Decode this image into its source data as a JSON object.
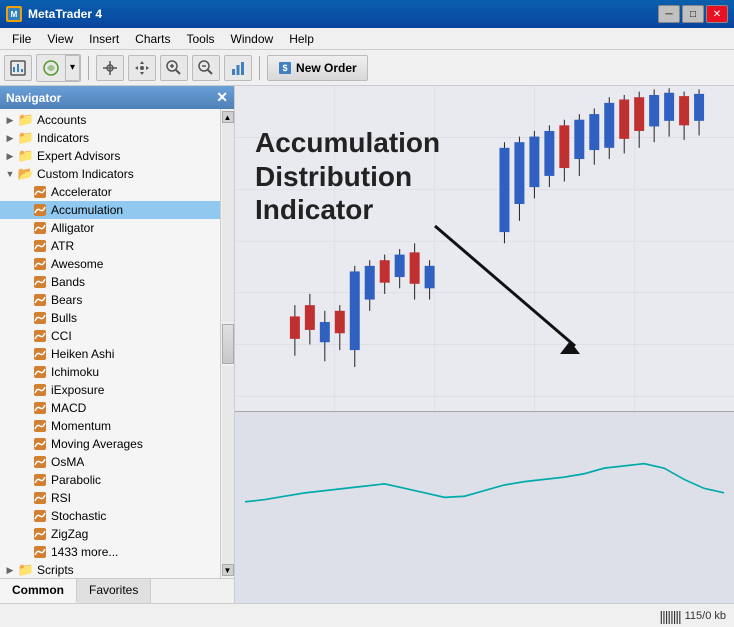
{
  "titleBar": {
    "title": "MetaTrader 4",
    "iconLabel": "MT",
    "controls": [
      "─",
      "□",
      "✕"
    ]
  },
  "menuBar": {
    "items": [
      "File",
      "View",
      "Insert",
      "Charts",
      "Tools",
      "Window",
      "Help"
    ]
  },
  "toolbar": {
    "newOrderLabel": "New Order"
  },
  "navigator": {
    "title": "Navigator",
    "sections": [
      {
        "id": "accounts",
        "label": "Accounts",
        "type": "root",
        "expanded": false
      },
      {
        "id": "indicators",
        "label": "Indicators",
        "type": "root",
        "expanded": false
      },
      {
        "id": "expert-advisors",
        "label": "Expert Advisors",
        "type": "root",
        "expanded": false
      },
      {
        "id": "custom-indicators",
        "label": "Custom Indicators",
        "type": "root",
        "expanded": true
      }
    ],
    "indicators": [
      "Accelerator",
      "Accumulation",
      "Alligator",
      "ATR",
      "Awesome",
      "Bands",
      "Bears",
      "Bulls",
      "CCI",
      "Heiken Ashi",
      "Ichimoku",
      "iExposure",
      "MACD",
      "Momentum",
      "Moving Averages",
      "OsMA",
      "Parabolic",
      "RSI",
      "Stochastic",
      "ZigZag",
      "1433 more..."
    ],
    "scripts": {
      "label": "Scripts"
    },
    "tabs": [
      "Common",
      "Favorites"
    ]
  },
  "annotation": {
    "line1": "Accumulation",
    "line2": "Distribution",
    "line3": "Indicator"
  },
  "statusBar": {
    "memoryLabel": "115/0 kb",
    "memIcon": "||||||||"
  }
}
